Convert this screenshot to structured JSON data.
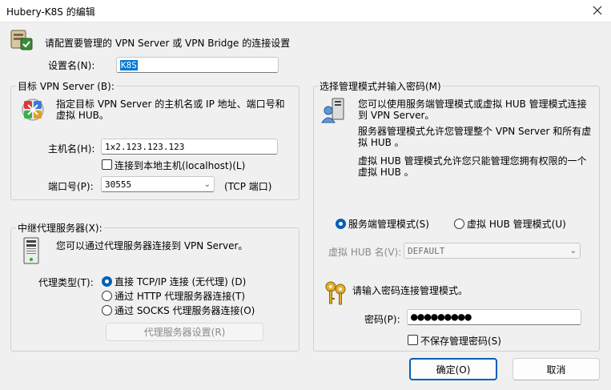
{
  "window": {
    "title": "Hubery-K8S 的编辑",
    "close_glyph": "X"
  },
  "header": {
    "prompt": "请配置要管理的 VPN Server 或 VPN Bridge 的连接设置"
  },
  "setting_name": {
    "label": "设置名(N):",
    "value": "K8S"
  },
  "target": {
    "group_title": "目标 VPN Server (B):",
    "description": "指定目标 VPN Server 的主机名或 IP 地址、端口号和虚拟 HUB。",
    "host_label": "主机名(H):",
    "host_value": "1x2.123.123.123",
    "localhost_label": "连接到本地主机(localhost)(L)",
    "port_label": "端口号(P):",
    "port_value": "30555",
    "port_suffix": "(TCP 端口)"
  },
  "proxy": {
    "group_title": "中继代理服务器(X):",
    "description": "您可以通过代理服务器连接到 VPN Server。",
    "type_label": "代理类型(T):",
    "options": [
      {
        "label": "直接 TCP/IP 连接 (无代理) (D)",
        "selected": true
      },
      {
        "label": "通过 HTTP 代理服务器连接(T)",
        "selected": false
      },
      {
        "label": "通过 SOCKS 代理服务器连接(O)",
        "selected": false
      }
    ],
    "settings_button": "代理服务器设置(R)"
  },
  "admin": {
    "group_title": "选择管理模式并输入密码(M)",
    "info1": "您可以使用服务端管理模式或虚拟 HUB 管理模式连接到 VPN Server。",
    "info2": "服务器管理模式允许您管理整个 VPN Server 和所有虚拟 HUB 。",
    "info3": "虚拟 HUB 管理模式允许您只能管理您拥有权限的一个虚拟 HUB 。",
    "mode_server": "服务端管理模式(S)",
    "mode_hub": "虚拟 HUB 管理模式(U)",
    "hub_name_label": "虚拟 HUB 名(V):",
    "hub_name_value": "DEFAULT",
    "password_prompt": "请输入密码连接管理模式。",
    "password_label": "密码(P):",
    "password_value": "●●●●●●●●●",
    "no_save_label": "不保存管理密码(S)"
  },
  "footer": {
    "ok": "确定(O)",
    "cancel": "取消"
  },
  "colors": {
    "accent": "#005fb8",
    "selection": "#0078d7"
  }
}
